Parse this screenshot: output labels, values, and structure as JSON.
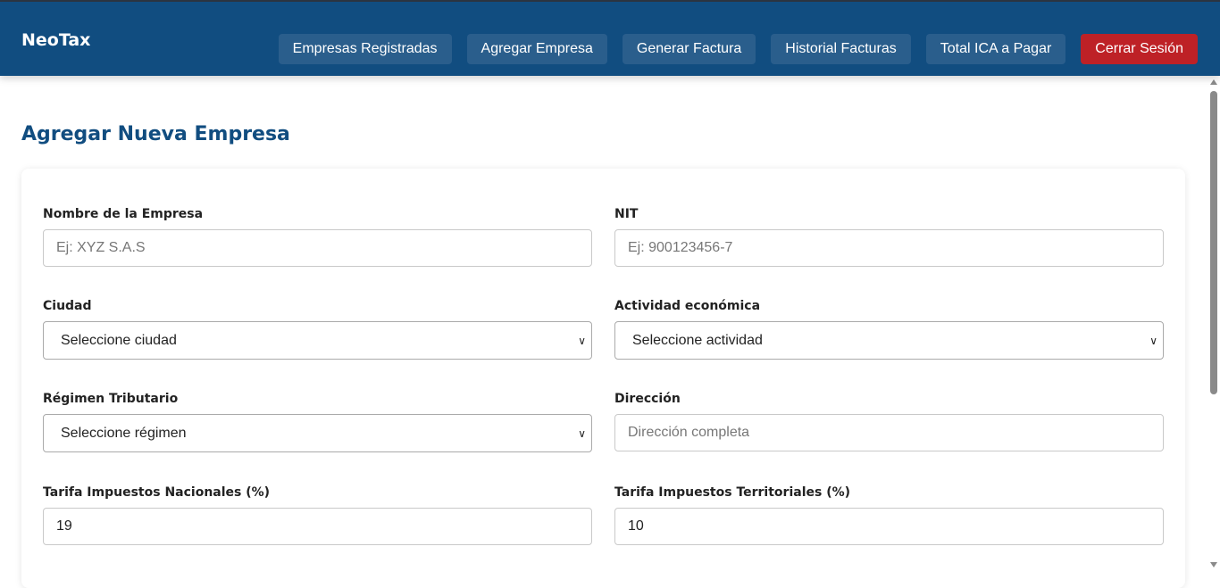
{
  "app": {
    "title": "NeoTax"
  },
  "nav": [
    {
      "label": "Empresas Registradas"
    },
    {
      "label": "Agregar Empresa"
    },
    {
      "label": "Generar Factura"
    },
    {
      "label": "Historial Facturas"
    },
    {
      "label": "Total ICA a Pagar"
    },
    {
      "label": "Cerrar Sesión"
    }
  ],
  "page": {
    "title": "Agregar Nueva Empresa"
  },
  "form": {
    "nombre": {
      "label": "Nombre de la Empresa",
      "placeholder": "Ej: XYZ S.A.S",
      "value": ""
    },
    "nit": {
      "label": "NIT",
      "placeholder": "Ej: 900123456-7",
      "value": ""
    },
    "ciudad": {
      "label": "Ciudad",
      "selected": "Seleccione ciudad"
    },
    "actividad": {
      "label": "Actividad económica",
      "selected": "Seleccione actividad"
    },
    "regimen": {
      "label": "Régimen Tributario",
      "selected": "Seleccione régimen"
    },
    "direccion": {
      "label": "Dirección",
      "placeholder": "Dirección completa",
      "value": ""
    },
    "tarifa_nacional": {
      "label": "Tarifa Impuestos Nacionales (%)",
      "value": "19"
    },
    "tarifa_territorial": {
      "label": "Tarifa Impuestos Territoriales (%)",
      "value": "10"
    }
  },
  "colors": {
    "header": "#114d80",
    "nav_button": "#2a5e8c",
    "logout": "#be2126"
  }
}
